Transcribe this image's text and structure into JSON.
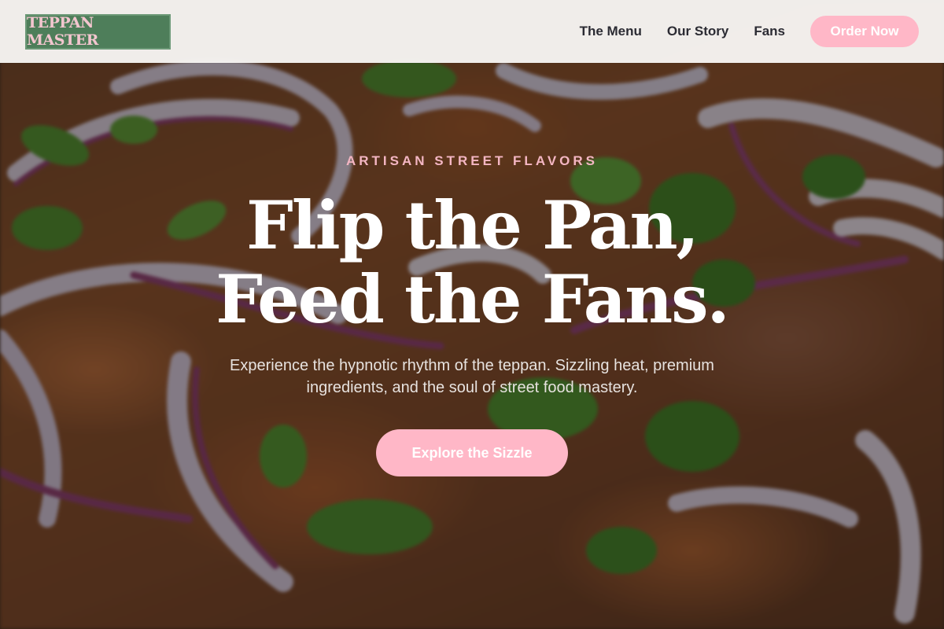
{
  "brand": {
    "logo_text": "TEPPAN MASTER"
  },
  "nav": {
    "links": [
      "The Menu",
      "Our Story",
      "Fans"
    ],
    "cta_label": "Order Now"
  },
  "hero": {
    "eyebrow": "ARTISAN STREET FLAVORS",
    "headline_line1": "Flip the Pan,",
    "headline_line2": "Feed the Fans.",
    "subtitle": "Experience the hypnotic rhythm of the teppan. Sizzling heat, premium ingredients, and the soul of street food mastery.",
    "cta_label": "Explore the Sizzle"
  },
  "colors": {
    "accent_pink": "#ffb7c7",
    "logo_green": "#4e7e5a",
    "nav_text": "#2b2b33"
  }
}
